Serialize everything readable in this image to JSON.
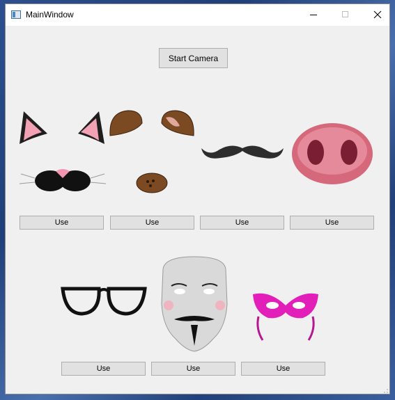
{
  "window": {
    "title": "MainWindow",
    "controls": {
      "minimize": "minimize-icon",
      "maximize": "maximize-icon",
      "close": "close-icon"
    }
  },
  "actions": {
    "start_camera_label": "Start Camera"
  },
  "filters_row1": [
    {
      "name": "cat-ears-and-nose",
      "button_label": "Use"
    },
    {
      "name": "dog-ears-and-nose",
      "button_label": "Use"
    },
    {
      "name": "mustache",
      "button_label": "Use"
    },
    {
      "name": "pig-nose",
      "button_label": "Use"
    }
  ],
  "filters_row2": [
    {
      "name": "glasses",
      "button_label": "Use"
    },
    {
      "name": "anonymous-mask",
      "button_label": "Use"
    },
    {
      "name": "masquerade-mask",
      "button_label": "Use"
    }
  ],
  "colors": {
    "window_bg": "#f0f0f0",
    "button_bg": "#e1e1e1",
    "button_border": "#adadad",
    "desktop": "#2d4f8f"
  }
}
